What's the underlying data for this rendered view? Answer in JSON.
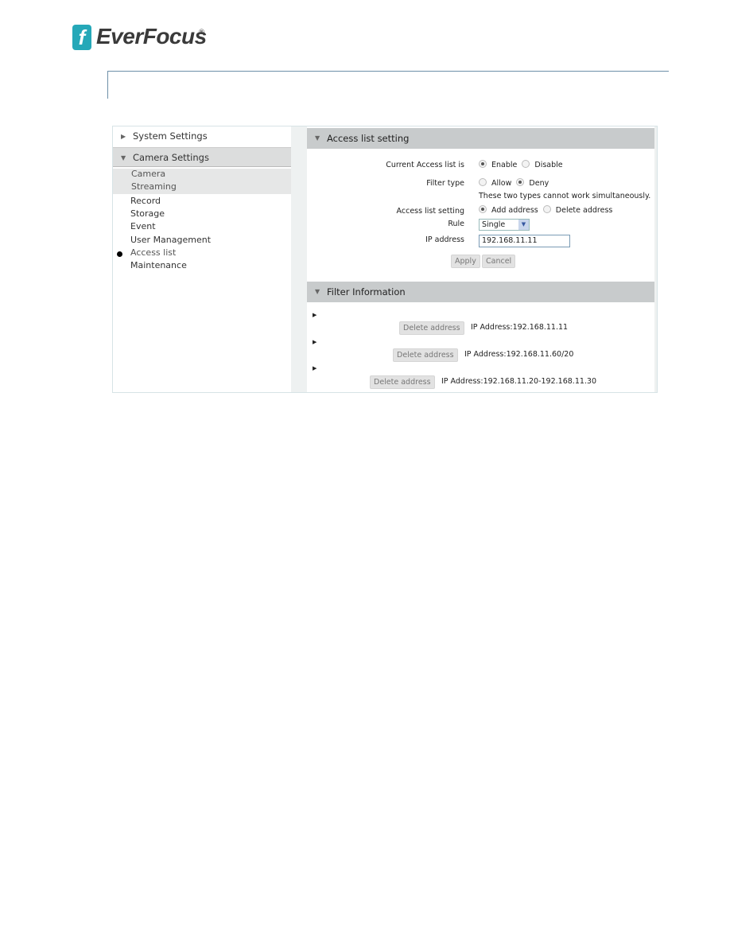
{
  "brand": {
    "name": "EverFocus",
    "mark": "®",
    "color": "#25a8b8"
  },
  "sidebar": {
    "sections": [
      {
        "label": "System Settings",
        "expanded": false
      },
      {
        "label": "Camera Settings",
        "expanded": true
      }
    ],
    "items": [
      {
        "label": "Camera"
      },
      {
        "label": "Streaming"
      },
      {
        "label": "Record"
      },
      {
        "label": "Storage"
      },
      {
        "label": "Event"
      },
      {
        "label": "User Management"
      },
      {
        "label": "Access list",
        "active": true
      },
      {
        "label": "Maintenance"
      }
    ]
  },
  "access": {
    "title": "Access list setting",
    "current_label": "Current Access list is",
    "enable": "Enable",
    "disable": "Disable",
    "current_value": "Enable",
    "filter_label": "Filter type",
    "allow": "Allow",
    "deny": "Deny",
    "filter_value": "Deny",
    "note": "These two types cannot work simultaneously.",
    "setting_label": "Access list setting",
    "add": "Add address",
    "delete": "Delete address",
    "setting_value": "Add address",
    "rule_label": "Rule",
    "rule_value": "Single",
    "ip_label": "IP address",
    "ip_value": "192.168.11.11",
    "apply": "Apply",
    "cancel": "Cancel"
  },
  "filter": {
    "title": "Filter Information",
    "entries": [
      {
        "button": "Delete address",
        "text": "IP Address:192.168.11.11"
      },
      {
        "button": "Delete address",
        "text": "IP Address:192.168.11.60/20"
      },
      {
        "button": "Delete address",
        "text": "IP Address:192.168.11.20-192.168.11.30"
      }
    ]
  }
}
